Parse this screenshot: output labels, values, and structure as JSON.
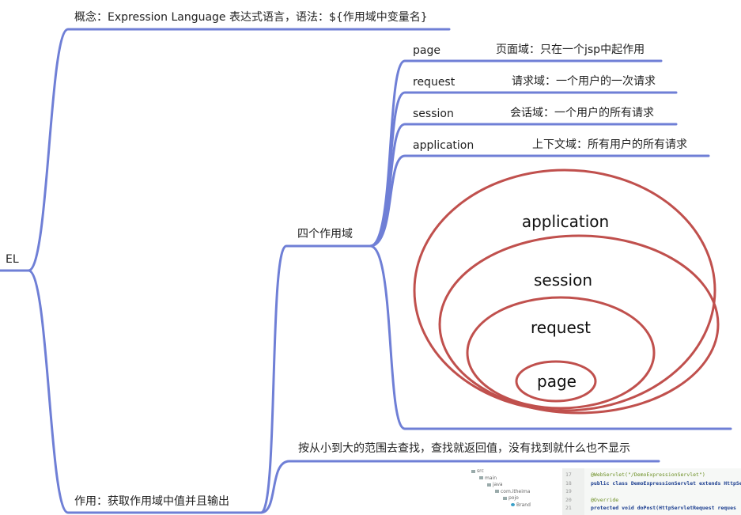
{
  "root": {
    "label": "EL"
  },
  "concept": {
    "label": "概念：Expression Language 表达式语言，语法：${作用域中变量名}"
  },
  "scopes": {
    "label": "四个作用域",
    "items": [
      {
        "name": "page",
        "desc": "页面域：只在一个jsp中起作用"
      },
      {
        "name": "request",
        "desc": "请求域：一个用户的一次请求"
      },
      {
        "name": "session",
        "desc": "会话域：一个用户的所有请求"
      },
      {
        "name": "application",
        "desc": "上下文域：所有用户的所有请求"
      }
    ],
    "nested": [
      "application",
      "session",
      "request",
      "page"
    ]
  },
  "usage": {
    "label": "作用：获取作用域中值并且输出",
    "detail": "按从小到大的范围去查找，查找就返回值，没有找到就什么也不显示"
  },
  "thumbnails": {
    "tree": [
      "src",
      "main",
      "java",
      "com.itheima",
      "pojo",
      "Brand"
    ],
    "code_line_numbers": [
      "17",
      "18",
      "19",
      "20",
      "21"
    ],
    "code_lines": [
      "@WebServlet(\"/DemoExpressionServlet\")",
      "public class DemoExpressionServlet extends HttpSer",
      "",
      "    @Override",
      "    protected void doPost(HttpServletRequest reques"
    ]
  },
  "colors": {
    "branch": "#6f7fd6",
    "ellipse": "#c0504d",
    "text": "#222222"
  }
}
